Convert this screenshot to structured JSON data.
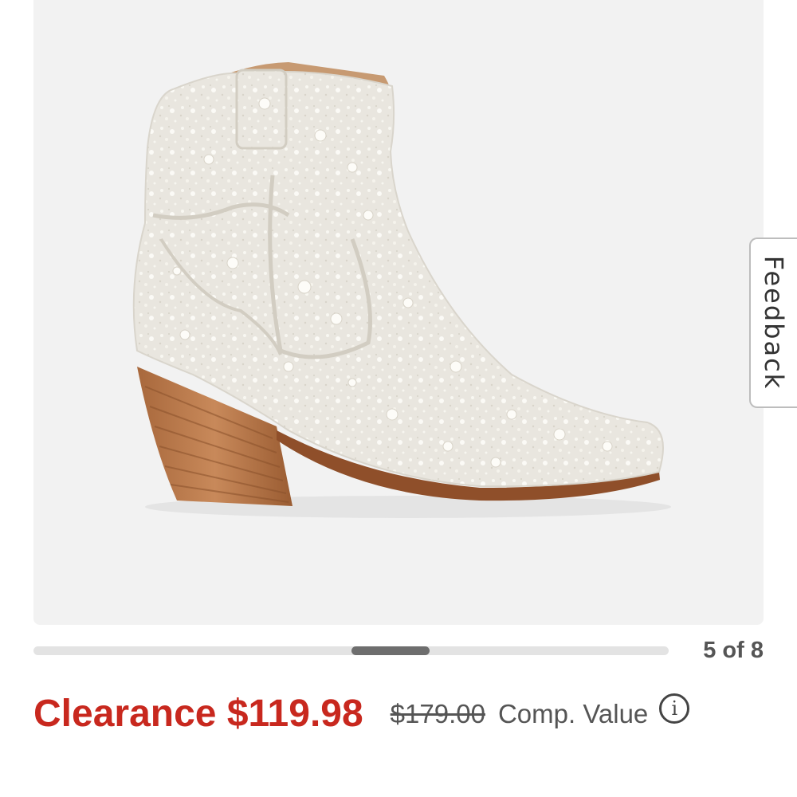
{
  "product_image": {
    "alt": "white pearl embellished western ankle boot with stacked wood heel",
    "icon": "boot-image"
  },
  "feedback": {
    "label": "Feedback"
  },
  "carousel": {
    "current": 5,
    "total": 8,
    "counter_text": "5 of 8"
  },
  "pricing": {
    "clearance_text": "Clearance $119.98",
    "original_price": "$179.00",
    "comp_value_label": "Comp. Value",
    "info_icon": "i",
    "sale_color": "#c8281e"
  }
}
